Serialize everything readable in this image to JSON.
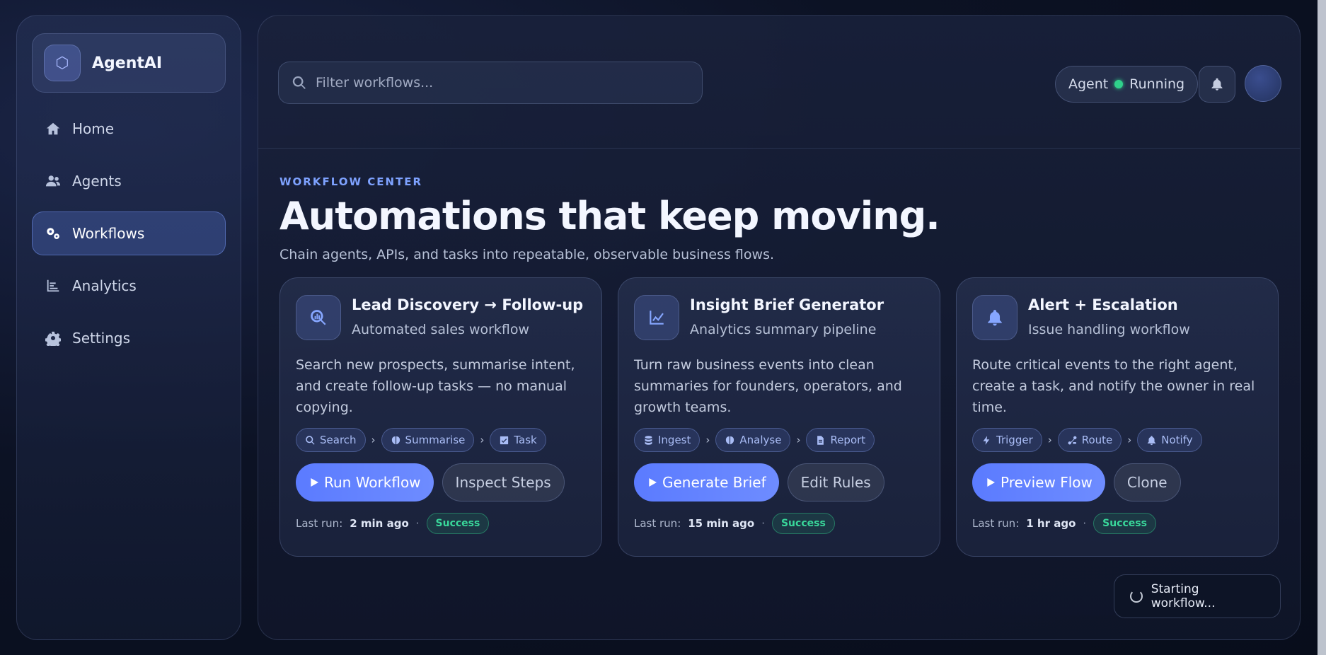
{
  "brand": {
    "name": "AgentAI",
    "logo_icon": "hexagon-icon"
  },
  "sidebar": {
    "items": [
      {
        "label": "Home",
        "icon": "home-icon",
        "active": false
      },
      {
        "label": "Agents",
        "icon": "users-icon",
        "active": false
      },
      {
        "label": "Workflows",
        "icon": "gears-icon",
        "active": true
      },
      {
        "label": "Analytics",
        "icon": "chart-icon",
        "active": false
      },
      {
        "label": "Settings",
        "icon": "gear-icon",
        "active": false
      }
    ]
  },
  "search": {
    "placeholder": "Filter workflows...",
    "value": ""
  },
  "status": {
    "prefix": "Agent",
    "state": "Running",
    "dot_color": "#2fd18b"
  },
  "hero": {
    "eyebrow": "WORKFLOW CENTER",
    "title": "Automations that keep moving.",
    "subtitle": "Chain agents, APIs, and tasks into repeatable, observable business flows."
  },
  "cards": [
    {
      "icon": "search-chart-icon",
      "title": "Lead Discovery → Follow-up",
      "subtitle": "Automated sales workflow",
      "description": "Search new prospects, summarise intent, and create follow-up tasks — no manual copying.",
      "steps": [
        {
          "label": "Search",
          "icon": "search-icon"
        },
        {
          "label": "Summarise",
          "icon": "brain-icon"
        },
        {
          "label": "Task",
          "icon": "checkbox-icon"
        }
      ],
      "primary": "Run Workflow",
      "secondary": "Inspect Steps",
      "last_run_label": "Last run:",
      "last_run": "2 min ago",
      "status": "Success"
    },
    {
      "icon": "line-chart-icon",
      "title": "Insight Brief Generator",
      "subtitle": "Analytics summary pipeline",
      "description": "Turn raw business events into clean summaries for founders, operators, and growth teams.",
      "steps": [
        {
          "label": "Ingest",
          "icon": "database-icon"
        },
        {
          "label": "Analyse",
          "icon": "brain-icon"
        },
        {
          "label": "Report",
          "icon": "document-icon"
        }
      ],
      "primary": "Generate Brief",
      "secondary": "Edit Rules",
      "last_run_label": "Last run:",
      "last_run": "15 min ago",
      "status": "Success"
    },
    {
      "icon": "bell-icon",
      "title": "Alert + Escalation",
      "subtitle": "Issue handling workflow",
      "description": "Route critical events to the right agent, create a task, and notify the owner in real time.",
      "steps": [
        {
          "label": "Trigger",
          "icon": "bolt-icon"
        },
        {
          "label": "Route",
          "icon": "route-icon"
        },
        {
          "label": "Notify",
          "icon": "bell-icon"
        }
      ],
      "primary": "Preview Flow",
      "secondary": "Clone",
      "last_run_label": "Last run:",
      "last_run": "1 hr ago",
      "status": "Success"
    }
  ],
  "toast": {
    "message": "Starting workflow..."
  },
  "colors": {
    "accent": "#5b7bff",
    "success": "#39d79a",
    "eyebrow": "#7ea2ff"
  }
}
